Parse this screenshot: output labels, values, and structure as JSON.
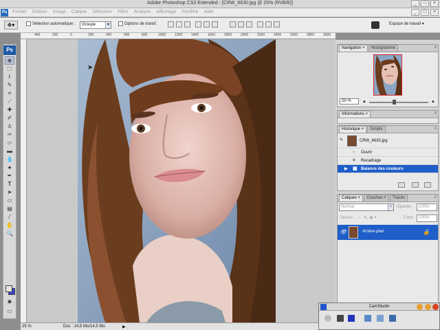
{
  "window": {
    "title": "Adobe Photoshop CS3 Extended - [CRW_6630.jpg @ 25% (RVB/8)]",
    "controls": [
      "_",
      "□",
      "×"
    ]
  },
  "menubar": {
    "logo": "Ps",
    "items": [
      "Fichier",
      "Edition",
      "Image",
      "Calque",
      "Sélection",
      "Filtre",
      "Analyse",
      "Affichage",
      "Fenêtre",
      "Aide"
    ],
    "doc_controls": [
      "_",
      "□",
      "×"
    ]
  },
  "options": {
    "auto_select_label": "Sélection automatique :",
    "auto_select_value": "Groupe",
    "transform_label": "Options de transf.",
    "workspace_label": "Espace de travail ▾"
  },
  "toolbox": {
    "logo": "Ps"
  },
  "ruler": {
    "top_ticks": [
      "400",
      "200",
      "0",
      "200",
      "400",
      "600",
      "800",
      "1000",
      "1200",
      "1400",
      "1600",
      "1800",
      "2000",
      "2200",
      "2400",
      "2600",
      "2800",
      "3000"
    ]
  },
  "status": {
    "zoom": "25 %",
    "doc": "Doc : 14,5 Mo/14,5 Mo"
  },
  "navigator": {
    "tabs": [
      "Navigation ×",
      "Histogramme"
    ],
    "zoom": "25 %"
  },
  "info": {
    "tabs": [
      "Informations ×"
    ]
  },
  "history": {
    "tabs": [
      "Historique ×",
      "Scripts"
    ],
    "snapshot": "CRW_6630.jpg",
    "steps": [
      "Ouvrir",
      "Recadrage",
      "Balance des couleurs"
    ]
  },
  "layers": {
    "tabs": [
      "Calques ×",
      "Couches ×",
      "Tracés"
    ],
    "blend_mode": "Normal",
    "opacity_label": "Opacité :",
    "opacity_value": "100%",
    "lock_label": "Verrou :",
    "fill_label": "Fond :",
    "fill_value": "100%",
    "layer_name": "Arrière-plan"
  },
  "camstudio": {
    "title": "CamStudio"
  },
  "colors": {
    "accent": "#1f5ec8",
    "fg_swatch": "#e8e4da",
    "bg_swatch": "#3b3fd0"
  }
}
